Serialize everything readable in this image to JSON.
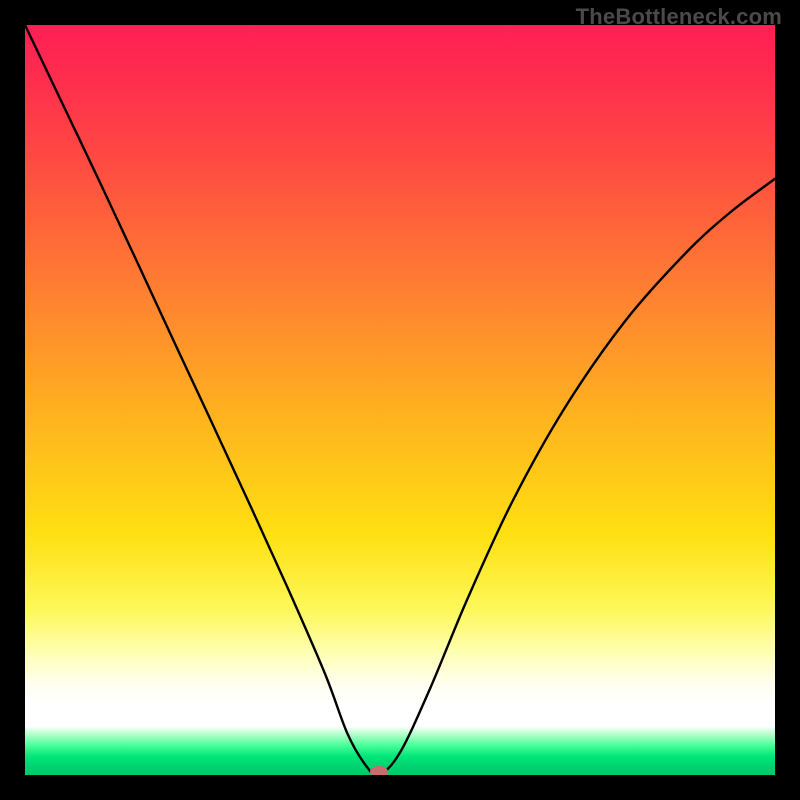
{
  "watermark": "TheBottleneck.com",
  "chart_data": {
    "type": "line",
    "title": "",
    "xlabel": "",
    "ylabel": "",
    "xlim": [
      0,
      1
    ],
    "ylim": [
      0,
      1
    ],
    "grid": false,
    "background_gradient": {
      "direction": "top-to-bottom",
      "stops": [
        {
          "pos": 0.0,
          "color": "#ff1f55"
        },
        {
          "pos": 0.18,
          "color": "#ff4a42"
        },
        {
          "pos": 0.52,
          "color": "#ffb21f"
        },
        {
          "pos": 0.78,
          "color": "#fdf85a"
        },
        {
          "pos": 0.91,
          "color": "#ffffff"
        },
        {
          "pos": 0.96,
          "color": "#4cff9a"
        },
        {
          "pos": 1.0,
          "color": "#00c968"
        }
      ]
    },
    "series": [
      {
        "name": "bottleneck-curve",
        "x": [
          0.0,
          0.05,
          0.1,
          0.15,
          0.2,
          0.25,
          0.3,
          0.35,
          0.4,
          0.43,
          0.455,
          0.472,
          0.5,
          0.54,
          0.59,
          0.65,
          0.72,
          0.8,
          0.88,
          0.94,
          1.0
        ],
        "y": [
          1.0,
          0.895,
          0.79,
          0.683,
          0.575,
          0.468,
          0.36,
          0.25,
          0.135,
          0.055,
          0.012,
          0.0,
          0.03,
          0.115,
          0.235,
          0.365,
          0.49,
          0.605,
          0.695,
          0.75,
          0.795
        ]
      }
    ],
    "marker": {
      "name": "optimal-point",
      "x": 0.472,
      "y": 0.0,
      "rx": 0.012,
      "ry": 0.008,
      "color": "#cc6a6d"
    }
  }
}
